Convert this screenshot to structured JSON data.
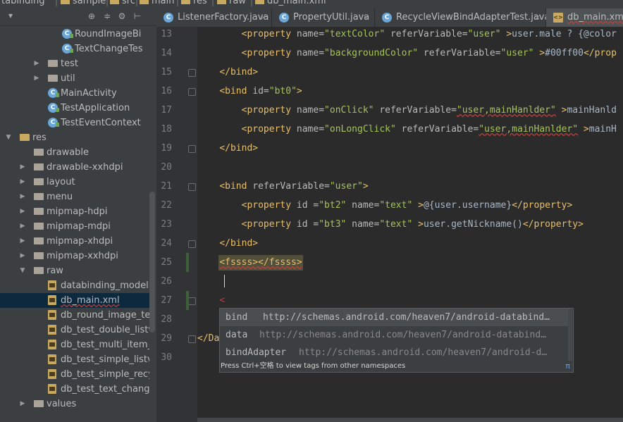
{
  "breadcrumb": {
    "items": [
      "tabinding",
      "sample",
      "src",
      "main",
      "res",
      "raw",
      "db_main.xml"
    ]
  },
  "sidebar": {
    "tree": [
      {
        "label": "RoundImageBi",
        "kind": "class"
      },
      {
        "label": "TextChangeTes",
        "kind": "class"
      },
      {
        "label": "test",
        "kind": "folder"
      },
      {
        "label": "util",
        "kind": "folder"
      },
      {
        "label": "MainActivity",
        "kind": "class"
      },
      {
        "label": "TestApplication",
        "kind": "class"
      },
      {
        "label": "TestEventContext",
        "kind": "class"
      },
      {
        "label": "res",
        "kind": "res-folder"
      },
      {
        "label": "drawable",
        "kind": "folder"
      },
      {
        "label": "drawable-xxhdpi",
        "kind": "folder"
      },
      {
        "label": "layout",
        "kind": "folder"
      },
      {
        "label": "menu",
        "kind": "folder"
      },
      {
        "label": "mipmap-hdpi",
        "kind": "folder"
      },
      {
        "label": "mipmap-mdpi",
        "kind": "folder"
      },
      {
        "label": "mipmap-xhdpi",
        "kind": "folder"
      },
      {
        "label": "mipmap-xxhdpi",
        "kind": "folder"
      },
      {
        "label": "raw",
        "kind": "folder"
      },
      {
        "label": "databinding_model.xr",
        "kind": "file"
      },
      {
        "label": "db_main.xml",
        "kind": "file",
        "selected": true
      },
      {
        "label": "db_round_image_test",
        "kind": "file"
      },
      {
        "label": "db_test_double_listvie",
        "kind": "file"
      },
      {
        "label": "db_test_multi_item_lis",
        "kind": "file"
      },
      {
        "label": "db_test_simple_listviev",
        "kind": "file"
      },
      {
        "label": "db_test_simple_recycl",
        "kind": "file"
      },
      {
        "label": "db_test_text_change.x",
        "kind": "file"
      },
      {
        "label": "values",
        "kind": "folder"
      }
    ],
    "toolbar_icons": [
      "target-icon",
      "collapse-icon",
      "gear-icon",
      "hide-icon"
    ]
  },
  "tabs": [
    {
      "label": "ListenerFactory.java",
      "icon": "C",
      "active": false
    },
    {
      "label": "PropertyUtil.java",
      "icon": "C",
      "active": false
    },
    {
      "label": "RecycleViewBindAdapterTest.java",
      "icon": "C",
      "active": false
    },
    {
      "label": "db_main.xml",
      "icon": "<>",
      "active": true
    }
  ],
  "tab_close_glyph": "×",
  "gutter": {
    "line_numbers": [
      "13",
      "14",
      "15",
      "16",
      "17",
      "18",
      "19",
      "20",
      "21",
      "22",
      "23",
      "24",
      "25",
      "26",
      "27",
      "28",
      "29",
      "30"
    ]
  },
  "code": {
    "lines": [
      {
        "indent": "        ",
        "tokens": [
          [
            "tag",
            "<property "
          ],
          [
            "attr",
            "name="
          ],
          [
            "val",
            "\"textColor\""
          ],
          [
            "attr",
            " referVariable="
          ],
          [
            "val",
            "\"user\""
          ],
          [
            "tag",
            " >"
          ],
          [
            "text",
            "user.male ? {@color"
          ]
        ]
      },
      {
        "indent": "        ",
        "tokens": [
          [
            "tag",
            "<property "
          ],
          [
            "attr",
            "name="
          ],
          [
            "val",
            "\"backgroundColor\""
          ],
          [
            "attr",
            " referVariable="
          ],
          [
            "val",
            "\"user\""
          ],
          [
            "tag",
            " >"
          ],
          [
            "text",
            "#00ff00"
          ],
          [
            "tag",
            "</prop"
          ]
        ]
      },
      {
        "indent": "    ",
        "tokens": [
          [
            "tag",
            "</bind>"
          ]
        ]
      },
      {
        "indent": "    ",
        "tokens": [
          [
            "tag",
            "<bind "
          ],
          [
            "attr",
            "id="
          ],
          [
            "val",
            "\"bt0\""
          ],
          [
            "tag",
            ">"
          ]
        ]
      },
      {
        "indent": "        ",
        "tokens": [
          [
            "tag",
            "<property "
          ],
          [
            "attr",
            "name="
          ],
          [
            "val",
            "\"onClick\""
          ],
          [
            "attr",
            " referVariable="
          ],
          [
            "val",
            "\"user,mainHanlder\""
          ],
          [
            "tag",
            " >"
          ],
          [
            "text",
            "mainHanld"
          ]
        ]
      },
      {
        "indent": "        ",
        "tokens": [
          [
            "tag",
            "<property "
          ],
          [
            "attr",
            "name="
          ],
          [
            "val",
            "\"onLongClick\""
          ],
          [
            "attr",
            " referVariable="
          ],
          [
            "val",
            "\"user,mainHanlder\""
          ],
          [
            "tag",
            " >"
          ],
          [
            "text",
            "mainH"
          ]
        ]
      },
      {
        "indent": "    ",
        "tokens": [
          [
            "tag",
            "</bind>"
          ]
        ]
      },
      {
        "indent": "",
        "tokens": []
      },
      {
        "indent": "    ",
        "tokens": [
          [
            "tag",
            "<bind "
          ],
          [
            "attr",
            "referVariable="
          ],
          [
            "val",
            "\"user\""
          ],
          [
            "tag",
            ">"
          ]
        ]
      },
      {
        "indent": "        ",
        "tokens": [
          [
            "tag",
            "<property "
          ],
          [
            "attr",
            "id ="
          ],
          [
            "val",
            "\"bt2\""
          ],
          [
            "attr",
            " name="
          ],
          [
            "val",
            "\"text\""
          ],
          [
            "tag",
            " >"
          ],
          [
            "text",
            "@{user.username}"
          ],
          [
            "tag",
            "</property>"
          ]
        ]
      },
      {
        "indent": "        ",
        "tokens": [
          [
            "tag",
            "<property "
          ],
          [
            "attr",
            "id ="
          ],
          [
            "val",
            "\"bt3\""
          ],
          [
            "attr",
            " name="
          ],
          [
            "val",
            "\"text\""
          ],
          [
            "tag",
            " >"
          ],
          [
            "text",
            "user.getNickname()"
          ],
          [
            "tag",
            "</property>"
          ]
        ]
      },
      {
        "indent": "    ",
        "tokens": [
          [
            "tag",
            "</bind>"
          ]
        ]
      },
      {
        "indent": "    ",
        "tokens": [
          [
            "tag",
            "<fssss></fssss>"
          ]
        ]
      },
      {
        "indent": "",
        "tokens": []
      },
      {
        "indent": "    ",
        "tokens": [
          [
            "err",
            "<"
          ]
        ]
      },
      {
        "indent": "",
        "tokens": []
      },
      {
        "indent": "",
        "tokens": [
          [
            "tag",
            "</Da"
          ]
        ]
      },
      {
        "indent": "",
        "tokens": []
      }
    ]
  },
  "autocomplete": {
    "items": [
      {
        "name": "bind",
        "url": "http://schemas.android.com/heaven7/android-databind…"
      },
      {
        "name": "data",
        "url": "http://schemas.android.com/heaven7/android-databind…"
      },
      {
        "name": "bindAdapter",
        "url": "http://schemas.android.com/heaven7/android-d…"
      }
    ],
    "footer": "Press Ctrl+空格 to view tags from other namespaces",
    "footer_icon": "π"
  },
  "colors": {
    "background": "#2b2b2b",
    "panel": "#3c3f41",
    "tag": "#e8bf6a",
    "value": "#a5c25c",
    "selection": "#0d293e"
  }
}
